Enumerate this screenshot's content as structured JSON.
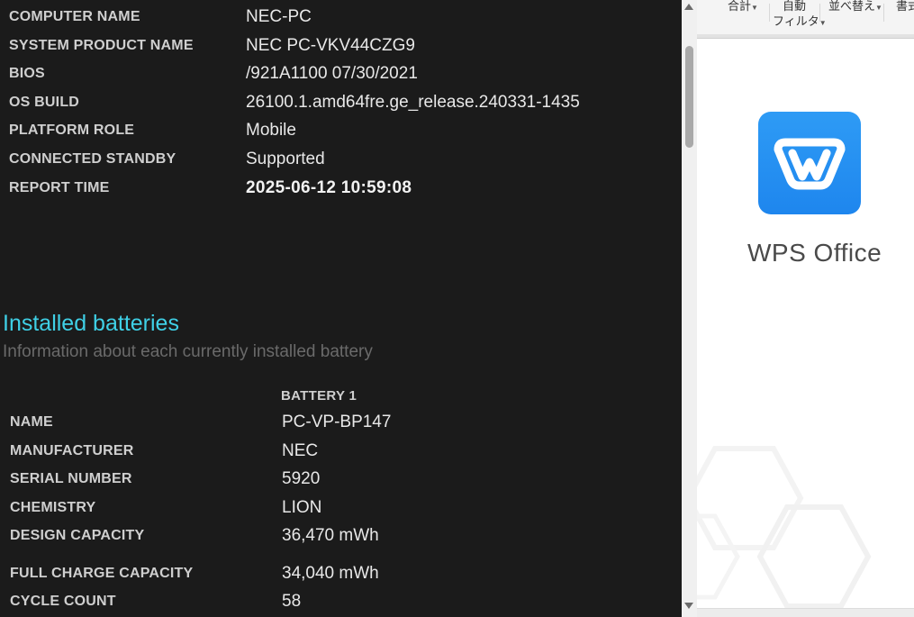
{
  "report": {
    "system_info": [
      {
        "label": "COMPUTER NAME",
        "value": "NEC-PC"
      },
      {
        "label": "SYSTEM PRODUCT NAME",
        "value": "NEC PC-VKV44CZG9"
      },
      {
        "label": "BIOS",
        "value": "/921A1100 07/30/2021"
      },
      {
        "label": "OS BUILD",
        "value": "26100.1.amd64fre.ge_release.240331-1435"
      },
      {
        "label": "PLATFORM ROLE",
        "value": "Mobile"
      },
      {
        "label": "CONNECTED STANDBY",
        "value": "Supported"
      },
      {
        "label": "REPORT TIME",
        "value": "2025-06-12  10:59:08"
      }
    ],
    "batteries_section": {
      "title": "Installed batteries",
      "subtitle": "Information about each currently installed battery",
      "column_header": "BATTERY 1",
      "rows": [
        {
          "label": "NAME",
          "value": "PC-VP-BP147"
        },
        {
          "label": "MANUFACTURER",
          "value": "NEC"
        },
        {
          "label": "SERIAL NUMBER",
          "value": "5920"
        },
        {
          "label": "CHEMISTRY",
          "value": "LION"
        },
        {
          "label": "DESIGN CAPACITY",
          "value": "36,470 mWh"
        },
        {
          "label": "FULL CHARGE CAPACITY",
          "value": "34,040 mWh"
        },
        {
          "label": "CYCLE COUNT",
          "value": "58"
        }
      ]
    }
  },
  "wps_window": {
    "ribbon": {
      "sum_label": "合計",
      "auto_filter_line1": "自動",
      "auto_filter_line2": "フィルタ",
      "sort_label": "並べ替え",
      "format_label": "書式"
    },
    "splash": {
      "app_name": "WPS Office",
      "logo_icon": "wps-logo-icon",
      "brand_color": "#1e86ee"
    }
  },
  "colors": {
    "report_background": "#1b1b1b",
    "section_title": "#3fd0e6",
    "subtitle": "#6a6a6a"
  }
}
